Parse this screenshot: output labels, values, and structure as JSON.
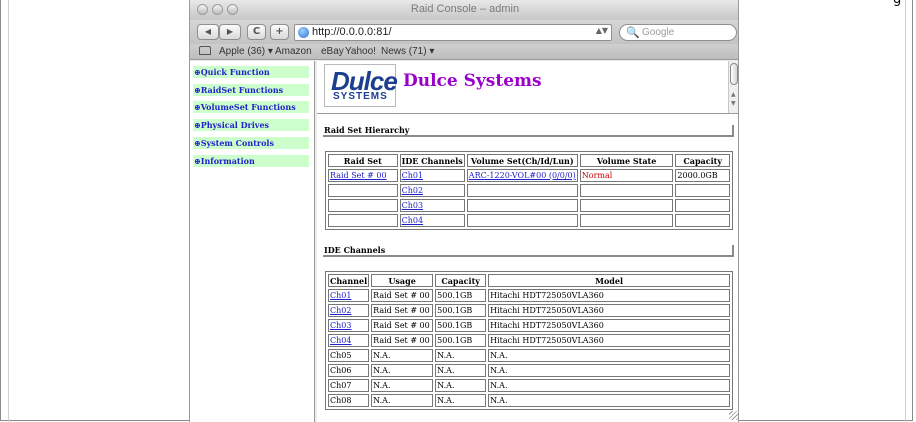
{
  "corner_fragment": "g",
  "window": {
    "title": "Raid Console – admin"
  },
  "toolbar": {
    "back_glyph": "◀",
    "forward_glyph": "▶",
    "reload_glyph": "C",
    "add_glyph": "+",
    "url": "http://0.0.0.0:81/",
    "search_placeholder": "Google"
  },
  "bookmarks": {
    "items": [
      "Apple (36) ▾",
      "Amazon",
      "eBay",
      "Yahoo!",
      "News (71) ▾"
    ]
  },
  "menu": {
    "items": [
      "⊕Quick Function",
      "⊕RaidSet Functions",
      "⊕VolumeSet Functions",
      "⊕Physical Drives",
      "⊕System Controls",
      "⊕Information"
    ]
  },
  "brand": {
    "logo_main": "Dulce",
    "logo_sub": "SYSTEMS",
    "name": "Dulce Systems"
  },
  "raid_hierarchy": {
    "title": "Raid Set Hierarchy",
    "headers": [
      "Raid Set",
      "IDE Channels",
      "Volume Set(Ch/Id/Lun)",
      "Volume State",
      "Capacity"
    ],
    "rows": [
      [
        "Raid Set # 00",
        "Ch01",
        "ARC-1220-VOL#00 (0/0/0)",
        "Normal",
        "2000.0GB"
      ],
      [
        "",
        "Ch02",
        "",
        "",
        ""
      ],
      [
        "",
        "Ch03",
        "",
        "",
        ""
      ],
      [
        "",
        "Ch04",
        "",
        "",
        ""
      ]
    ]
  },
  "ide_channels": {
    "title": "IDE Channels",
    "headers": [
      "Channel",
      "Usage",
      "Capacity",
      "Model"
    ],
    "rows": [
      [
        "Ch01",
        "Raid Set # 00",
        "500.1GB",
        "Hitachi HDT725050VLA360"
      ],
      [
        "Ch02",
        "Raid Set # 00",
        "500.1GB",
        "Hitachi HDT725050VLA360"
      ],
      [
        "Ch03",
        "Raid Set # 00",
        "500.1GB",
        "Hitachi HDT725050VLA360"
      ],
      [
        "Ch04",
        "Raid Set # 00",
        "500.1GB",
        "Hitachi HDT725050VLA360"
      ],
      [
        "Ch05",
        "N.A.",
        "N.A.",
        "N.A."
      ],
      [
        "Ch06",
        "N.A.",
        "N.A.",
        "N.A."
      ],
      [
        "Ch07",
        "N.A.",
        "N.A.",
        "N.A."
      ],
      [
        "Ch08",
        "N.A.",
        "N.A.",
        "N.A."
      ]
    ]
  },
  "colors": {
    "menu_bg": "#ccffcc",
    "link": "#2222cc",
    "brand": "#9900cc",
    "state_normal": "#cc0000"
  }
}
